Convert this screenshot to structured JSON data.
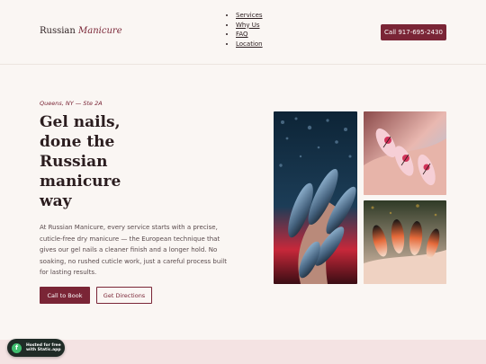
{
  "header": {
    "logo_word1": "Russian",
    "logo_word2": "Manicure",
    "nav": [
      "Services",
      "Why Us",
      "FAQ",
      "Location"
    ],
    "call_button": "Call 917-695-2430"
  },
  "hero": {
    "eyebrow": "Queens, NY — Ste 2A",
    "headline_lines": [
      "Gel nails,",
      "done the",
      "Russian",
      "manicure",
      "way"
    ],
    "lede": "At Russian Manicure, every service starts with a precise, cuticle-free dry manicure — the European technique that gives our gel nails a cleaner finish and a longer hold. No soaking, no rushed cuticle work, just a careful process built for lasting results.",
    "primary_button": "Call to Book",
    "secondary_button": "Get Directions"
  },
  "badge": {
    "icon_glyph": "f",
    "text": "Hosted for free\nwith Static.app"
  },
  "colors": {
    "accent": "#7a2536",
    "background": "#faf6f3",
    "band": "#f4e3e3",
    "badge_bg": "#1f2b26",
    "badge_icon": "#3fbf6f"
  }
}
